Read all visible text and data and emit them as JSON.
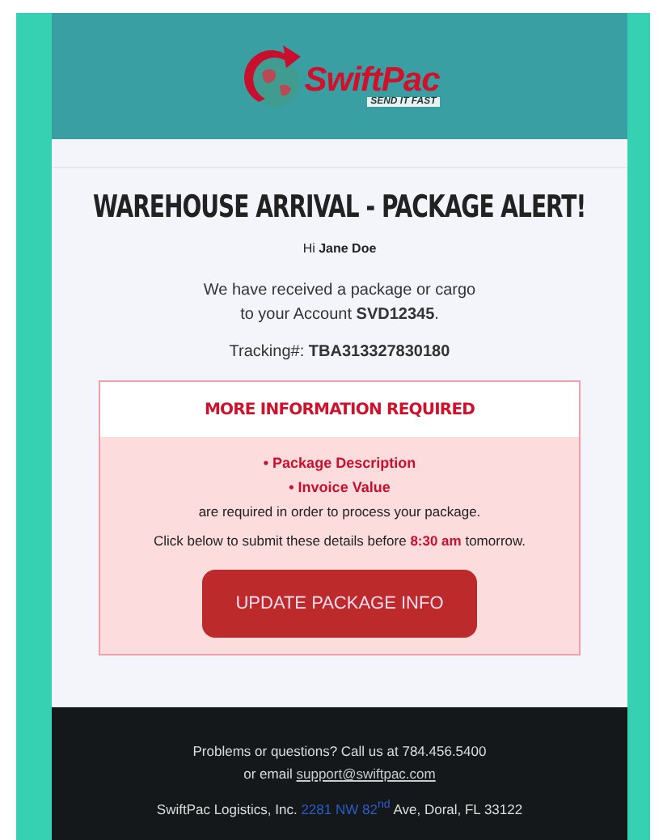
{
  "logo": {
    "name": "SwiftPac",
    "tagline": "SEND IT FAST"
  },
  "heading": "WAREHOUSE ARRIVAL - PACKAGE ALERT!",
  "greeting": "Hi **Jane Doe**",
  "message": [
    "We have received a package or cargo",
    "to your Account **SVD12345**."
  ],
  "tracking": "Tracking#: **TBA313327830180**",
  "alert": {
    "title": "MORE INFORMATION REQUIRED",
    "items": [
      "• Package Description",
      "• Invoice Value"
    ],
    "note": "are required in order to process your package.",
    "deadline": "Click below to submit these details before **8:30 am** tomorrow.",
    "button": "UPDATE PACKAGE INFO"
  },
  "footer": {
    "contact": "Problems or questions? Call us at 784.456.5400",
    "email_prefix": "or email",
    "email": "support@swiftpac.com",
    "company": "SwiftPac Logistics, Inc.",
    "address_link": "2281 NW 82$^{nd}$",
    "address_rest": "Ave, Doral, FL 33122"
  }
}
